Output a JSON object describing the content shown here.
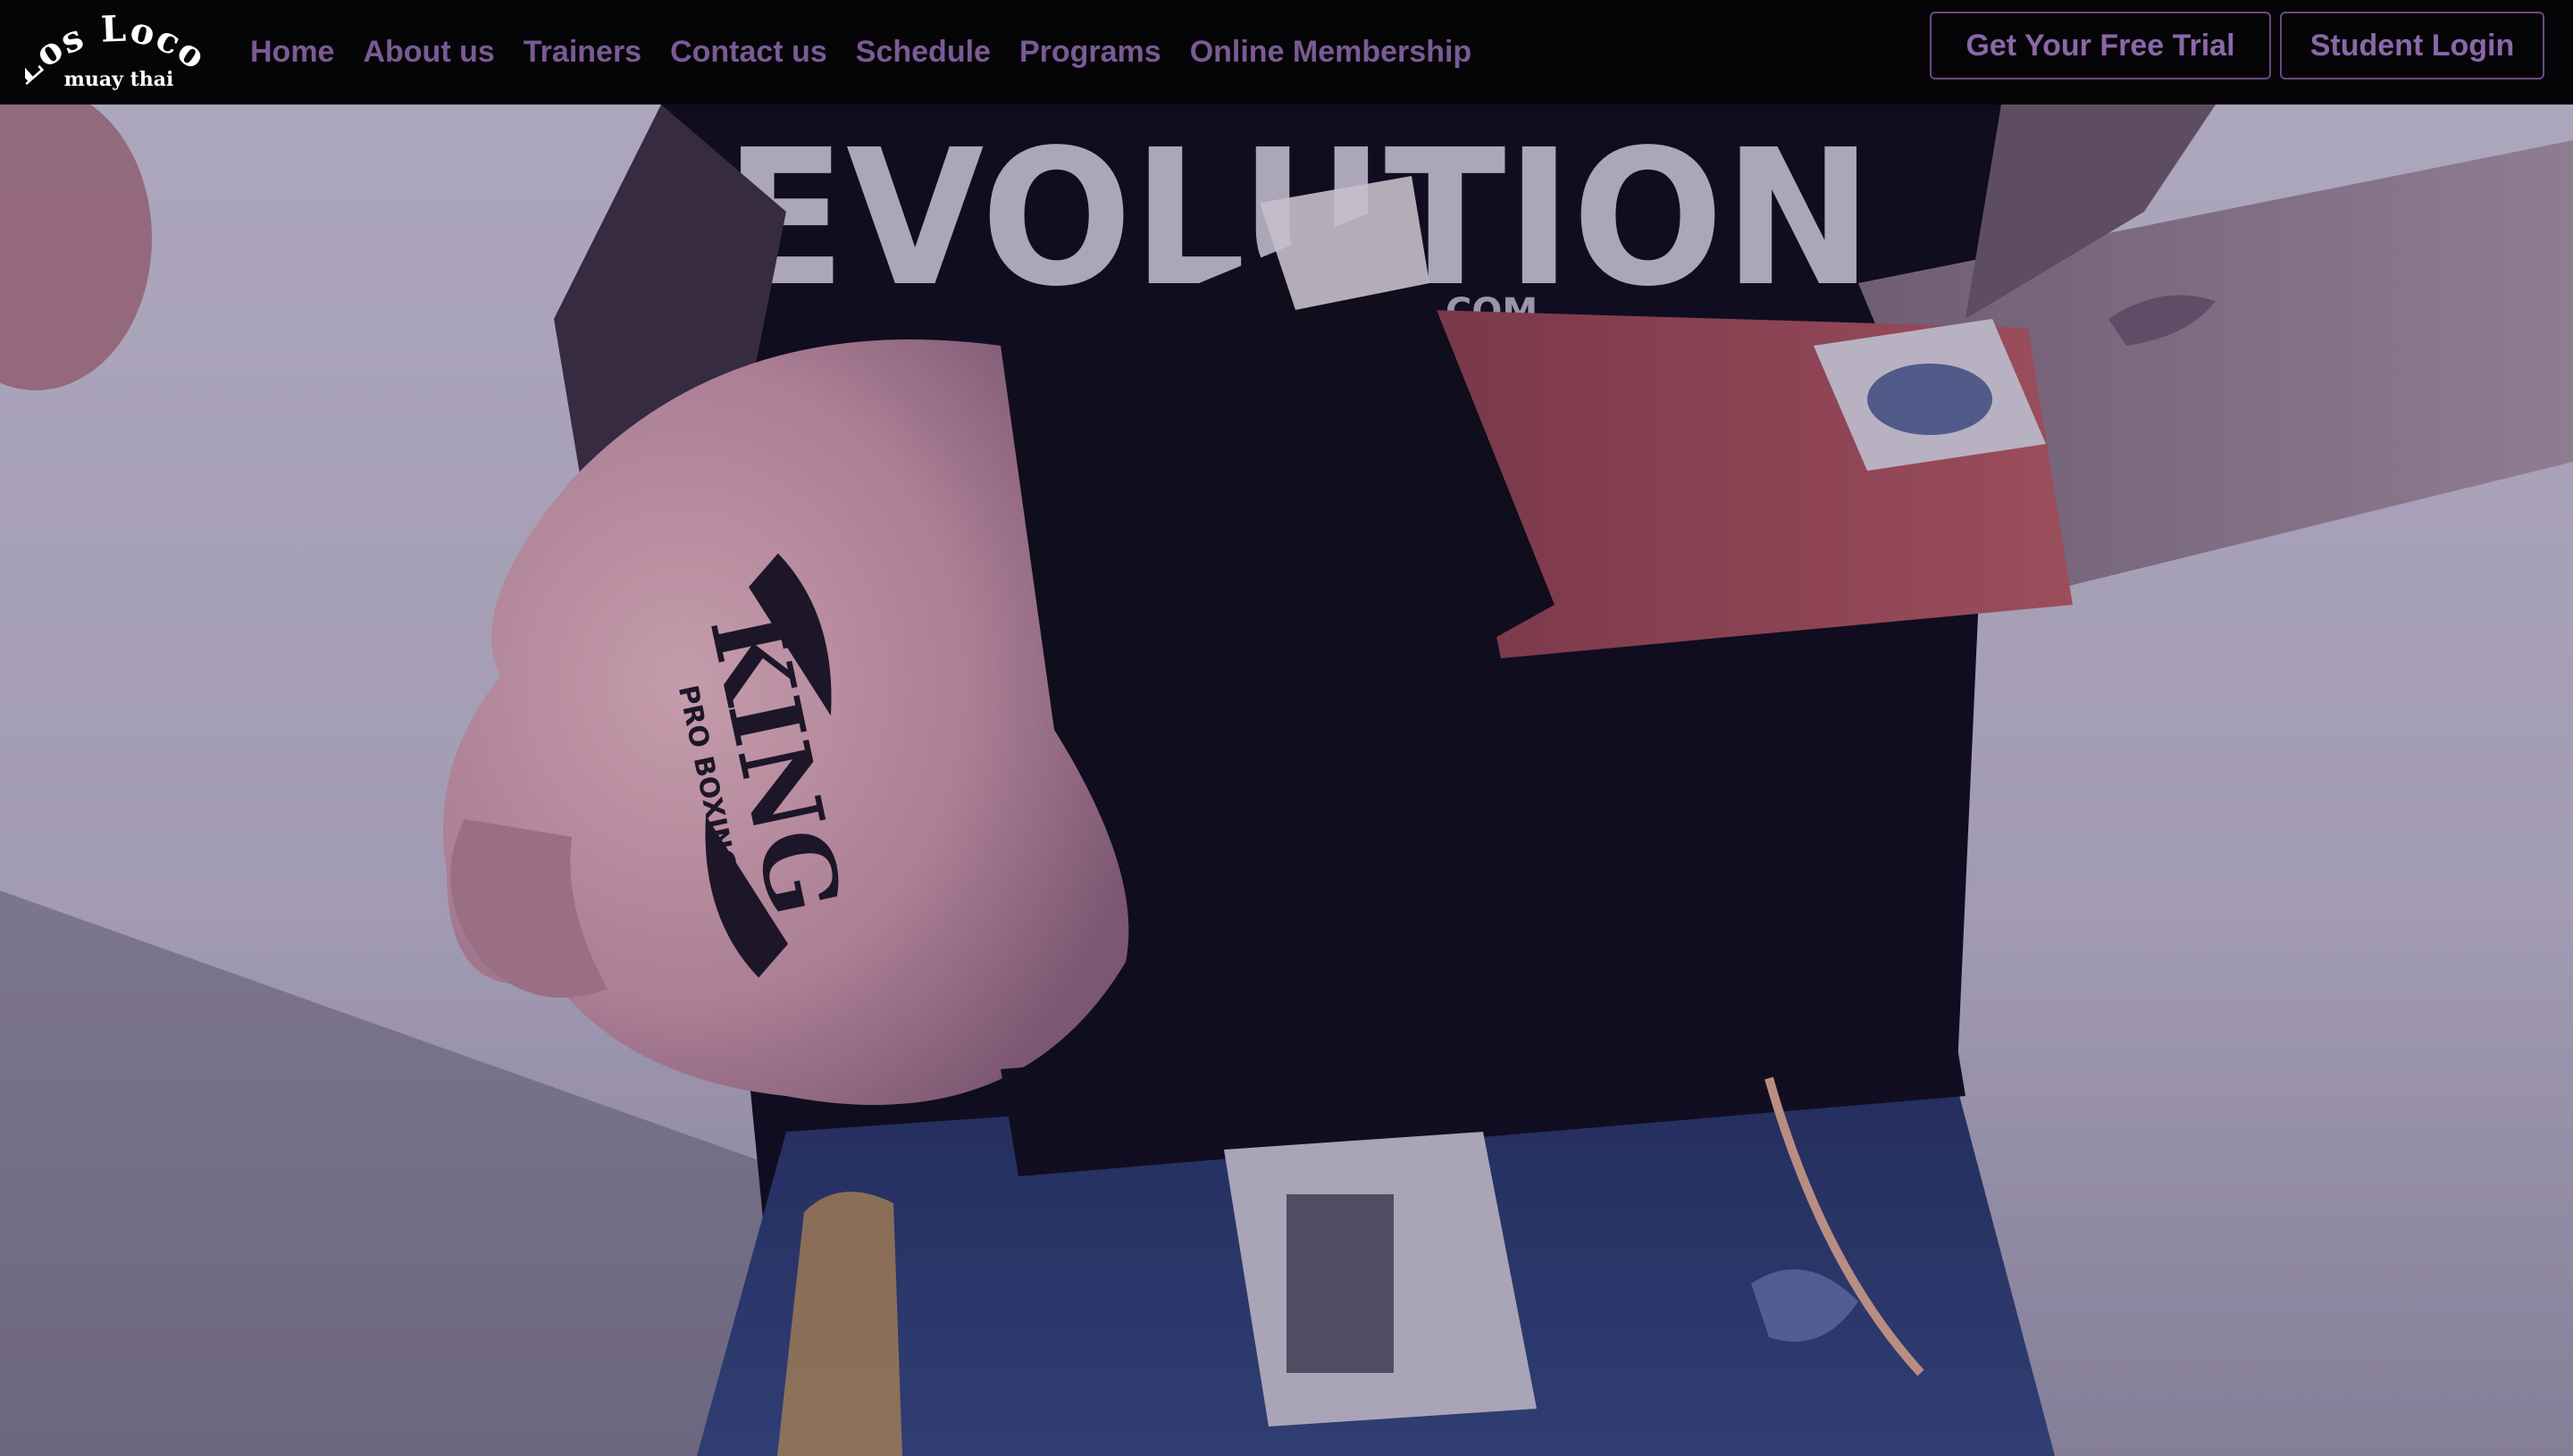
{
  "brand": {
    "logo_line1": "Los Locos",
    "logo_line2": "muay thai"
  },
  "nav": {
    "links": [
      {
        "label": "Home"
      },
      {
        "label": "About us"
      },
      {
        "label": "Trainers"
      },
      {
        "label": "Contact us"
      },
      {
        "label": "Schedule"
      },
      {
        "label": "Programs"
      },
      {
        "label": "Online Membership"
      }
    ],
    "trial_button": "Get Your Free Trial",
    "login_button": "Student Login"
  },
  "hero": {
    "shirt_text": "EVOLUTION",
    "shirt_subtext": "WWW.           AI.COM",
    "glove_brand": "KING",
    "glove_subtext": "PRO BOXING"
  },
  "colors": {
    "nav_bg": "#050407",
    "nav_link": "#7a5a94",
    "button_border": "#6a4a86",
    "button_text": "#8a68a8"
  }
}
